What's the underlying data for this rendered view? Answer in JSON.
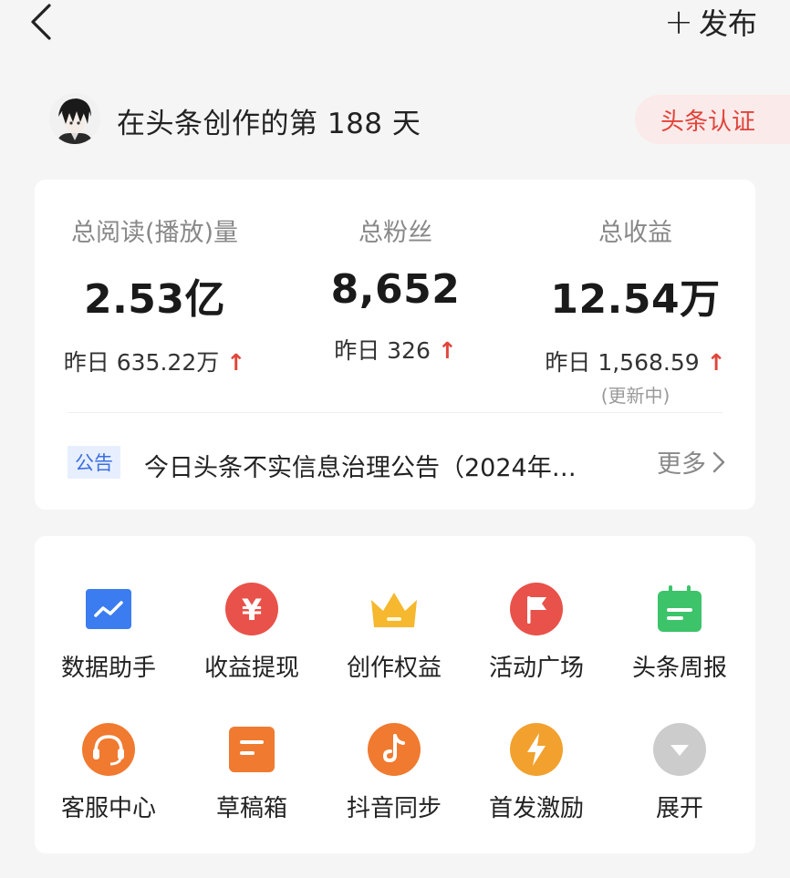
{
  "topbar": {
    "back_icon": "chevron-left-icon",
    "publish_plus": "+",
    "publish_label": "发布"
  },
  "profile": {
    "days_text": "在头条创作的第 188 天",
    "verify_label": "头条认证"
  },
  "stats": [
    {
      "label": "总阅读(播放)量",
      "value": "2.53亿",
      "yesterday": "昨日 635.22万",
      "arrow": "↑"
    },
    {
      "label": "总粉丝",
      "value": "8,652",
      "yesterday": "昨日 326",
      "arrow": "↑"
    },
    {
      "label": "总收益",
      "value": "12.54万",
      "yesterday": "昨日 1,568.59",
      "arrow": "↑",
      "note": "(更新中)"
    }
  ],
  "notice": {
    "tag": "公告",
    "text": "今日头条不实信息治理公告（2024年…",
    "more": "更多"
  },
  "tools": [
    {
      "label": "数据助手",
      "icon": "chart-trend-icon",
      "color": "#3b7cf0"
    },
    {
      "label": "收益提现",
      "icon": "yuan-coin-icon",
      "color": "#e8524a"
    },
    {
      "label": "创作权益",
      "icon": "crown-icon",
      "color": "#f5b82e"
    },
    {
      "label": "活动广场",
      "icon": "flag-icon",
      "color": "#e8524a"
    },
    {
      "label": "头条周报",
      "icon": "calendar-icon",
      "color": "#3dc36a"
    },
    {
      "label": "客服中心",
      "icon": "headset-icon",
      "color": "#f07a30"
    },
    {
      "label": "草稿箱",
      "icon": "draft-box-icon",
      "color": "#f07a30"
    },
    {
      "label": "抖音同步",
      "icon": "tiktok-icon",
      "color": "#f07a30"
    },
    {
      "label": "首发激励",
      "icon": "lightning-icon",
      "color": "#f2a12e"
    },
    {
      "label": "展开",
      "icon": "expand-down-icon",
      "color": "#cccccc"
    }
  ]
}
